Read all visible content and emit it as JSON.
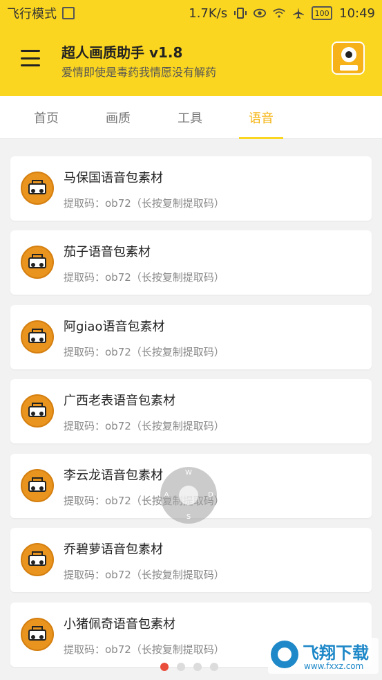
{
  "status_bar": {
    "left_text": "飞行模式",
    "speed": "1.7K/s",
    "battery": "100",
    "time": "10:49"
  },
  "header": {
    "title": "超人画质助手 v1.8",
    "subtitle": "爱情即使是毒药我情愿没有解药"
  },
  "tabs": [
    {
      "label": "首页"
    },
    {
      "label": "画质"
    },
    {
      "label": "工具"
    },
    {
      "label": "语音",
      "active": true
    }
  ],
  "items": [
    {
      "title": "马保国语音包素材",
      "sub": "提取码：ob72（长按复制提取码）"
    },
    {
      "title": "茄子语音包素材",
      "sub": "提取码：ob72（长按复制提取码）"
    },
    {
      "title": "阿giao语音包素材",
      "sub": "提取码：ob72（长按复制提取码）"
    },
    {
      "title": "广西老表语音包素材",
      "sub": "提取码：ob72（长按复制提取码）"
    },
    {
      "title": "李云龙语音包素材",
      "sub": "提取码：ob72（长按复制提取码）"
    },
    {
      "title": "乔碧萝语音包素材",
      "sub": "提取码：ob72（长按复制提取码）"
    },
    {
      "title": "小猪佩奇语音包素材",
      "sub": "提取码：ob72（长按复制提取码）"
    }
  ],
  "dpad": {
    "up": "W",
    "left": "A",
    "right": "D",
    "down": "S"
  },
  "watermark": {
    "text": "飞翔下载",
    "url": "www.fxxz.com"
  },
  "colors": {
    "accent": "#fbd620",
    "active_tab": "#f5b414",
    "dot_active": "#e94e3c"
  }
}
